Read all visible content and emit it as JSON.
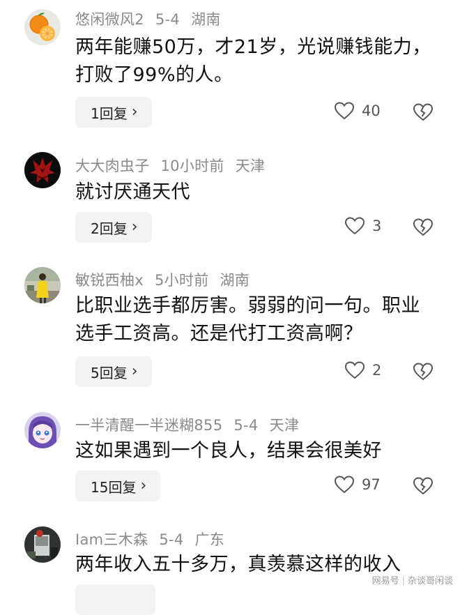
{
  "comments": [
    {
      "username": "悠闲微风2",
      "time": "5-4",
      "location": "湖南",
      "text": "两年能赚50万，才21岁，光说赚钱能力，打败了99%的人。",
      "reply_label": "1回复",
      "likes": "40",
      "avatar_icon": "orange-avatar-icon"
    },
    {
      "username": "大大肉虫子",
      "time": "10小时前",
      "location": "天津",
      "text": "就讨厌通天代",
      "reply_label": "2回复",
      "likes": "3",
      "avatar_icon": "horde-emblem-avatar-icon"
    },
    {
      "username": "敏锐西柚x",
      "time": "5小时前",
      "location": "湖南",
      "text": "比职业选手都厉害。弱弱的问一句。职业选手工资高。还是代打工资高啊？",
      "reply_label": "5回复",
      "likes": "2",
      "avatar_icon": "person-photo-avatar-icon"
    },
    {
      "username": "一半清醒一半迷糊855",
      "time": "5-4",
      "location": "天津",
      "text": "这如果遇到一个良人，结果会很美好",
      "reply_label": "15回复",
      "likes": "97",
      "avatar_icon": "anime-girl-avatar-icon"
    },
    {
      "username": "Iam三木森",
      "time": "5-4",
      "location": "广东",
      "text": "两年收入五十多万，真羡慕这样的收入",
      "reply_label": "",
      "likes": "",
      "avatar_icon": "dark-photo-avatar-icon"
    }
  ],
  "watermark": {
    "left": "网易号",
    "right": "杂谈哥闲谈"
  },
  "colors": {
    "meta_text": "#8a8a8a",
    "body_text": "#111111",
    "reply_bg": "#f3f3f3"
  }
}
